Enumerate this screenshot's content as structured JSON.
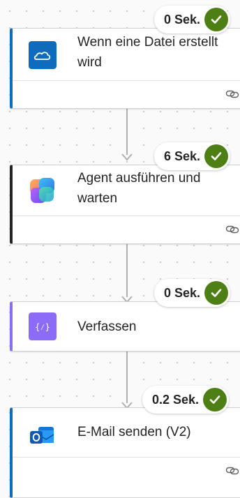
{
  "steps": [
    {
      "title": "Wenn eine Datei erstellt wird",
      "duration": "0 Sek.",
      "status": "succeeded",
      "icon": "onedrive-icon",
      "accent": "#0f6cbd"
    },
    {
      "title": "Agent ausführen und warten",
      "duration": "6 Sek.",
      "status": "succeeded",
      "icon": "copilot-icon",
      "accent": "#242424"
    },
    {
      "title": "Verfassen",
      "duration": "0 Sek.",
      "status": "succeeded",
      "icon": "compose-icon",
      "accent": "#8c6bf7"
    },
    {
      "title": "E-Mail senden (V2)",
      "duration": "0.2 Sek.",
      "status": "succeeded",
      "icon": "outlook-icon",
      "accent": "#0f6cbd"
    }
  ],
  "colors": {
    "success": "#4e7f14",
    "connector": "#b0b0b0"
  }
}
